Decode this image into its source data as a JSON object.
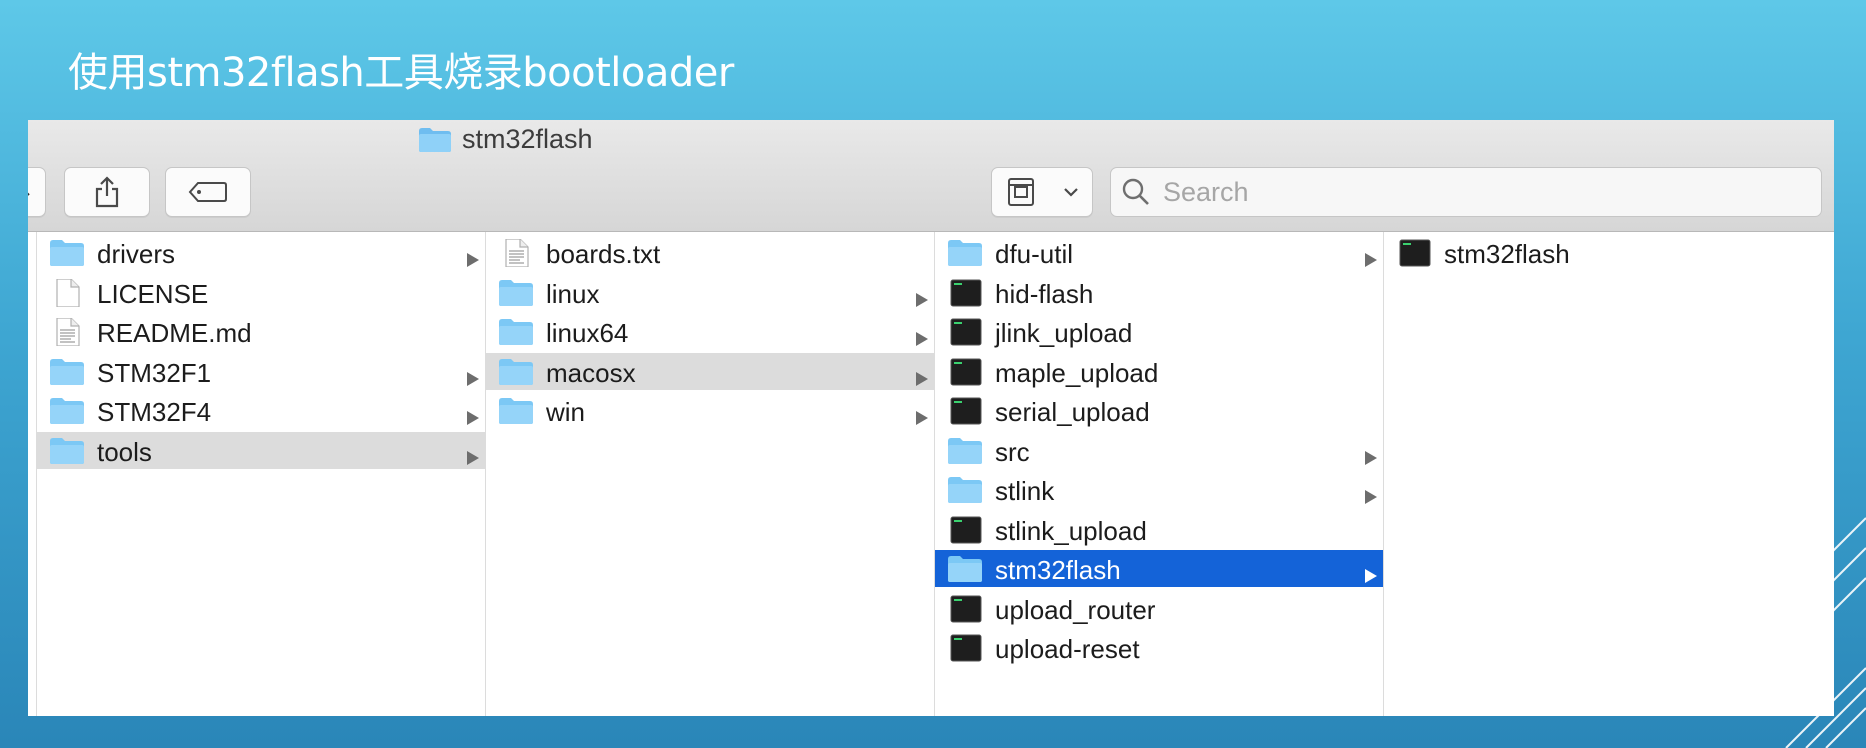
{
  "slide": {
    "title": "使用stm32flash工具烧录bootloader"
  },
  "window": {
    "title": "stm32flash",
    "title_icon": "folder-icon"
  },
  "toolbar": {
    "buttons": [
      "share-icon",
      "tag-icon",
      "action-menu-icon"
    ],
    "search": {
      "placeholder": "Search",
      "value": ""
    }
  },
  "colors": {
    "folder": "#7cc8f5",
    "selection_blue": "#1463d8",
    "selection_gray": "#dcdcdc"
  },
  "columns": [
    {
      "items": [
        {
          "label": "drivers",
          "icon": "folder-icon",
          "has_children": true
        },
        {
          "label": "LICENSE",
          "icon": "document-icon",
          "has_children": false
        },
        {
          "label": "README.md",
          "icon": "text-document-icon",
          "has_children": false
        },
        {
          "label": "STM32F1",
          "icon": "folder-icon",
          "has_children": true
        },
        {
          "label": "STM32F4",
          "icon": "folder-icon",
          "has_children": true
        },
        {
          "label": "tools",
          "icon": "folder-icon",
          "has_children": true,
          "selected": "gray"
        }
      ]
    },
    {
      "items": [
        {
          "label": "boards.txt",
          "icon": "text-document-icon",
          "has_children": false
        },
        {
          "label": "linux",
          "icon": "folder-icon",
          "has_children": true
        },
        {
          "label": "linux64",
          "icon": "folder-icon",
          "has_children": true
        },
        {
          "label": "macosx",
          "icon": "folder-icon",
          "has_children": true,
          "selected": "gray"
        },
        {
          "label": "win",
          "icon": "folder-icon",
          "has_children": true
        }
      ]
    },
    {
      "items": [
        {
          "label": "dfu-util",
          "icon": "folder-icon",
          "has_children": true
        },
        {
          "label": "hid-flash",
          "icon": "terminal-executable-icon",
          "has_children": false
        },
        {
          "label": "jlink_upload",
          "icon": "terminal-executable-icon",
          "has_children": false
        },
        {
          "label": "maple_upload",
          "icon": "terminal-executable-icon",
          "has_children": false
        },
        {
          "label": "serial_upload",
          "icon": "terminal-executable-icon",
          "has_children": false
        },
        {
          "label": "src",
          "icon": "folder-icon",
          "has_children": true
        },
        {
          "label": "stlink",
          "icon": "folder-icon",
          "has_children": true
        },
        {
          "label": "stlink_upload",
          "icon": "terminal-executable-icon",
          "has_children": false
        },
        {
          "label": "stm32flash",
          "icon": "folder-icon",
          "has_children": true,
          "selected": "blue"
        },
        {
          "label": "upload_router",
          "icon": "terminal-executable-icon",
          "has_children": false
        },
        {
          "label": "upload-reset",
          "icon": "terminal-executable-icon",
          "has_children": false
        }
      ]
    },
    {
      "items": [
        {
          "label": "stm32flash",
          "icon": "terminal-executable-icon",
          "has_children": false
        }
      ]
    }
  ]
}
